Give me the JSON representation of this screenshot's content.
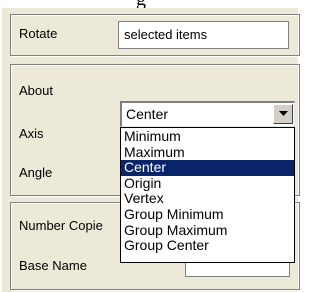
{
  "header": {
    "partial_title": "g"
  },
  "rotate": {
    "label": "Rotate",
    "value": "selected items"
  },
  "about": {
    "label": "About",
    "selected": "Center",
    "options": [
      "Minimum",
      "Maximum",
      "Center",
      "Origin",
      "Vertex",
      "Group Minimum",
      "Group Maximum",
      "Group Center"
    ],
    "highlighted_index": 2
  },
  "axis": {
    "label": "Axis"
  },
  "angle": {
    "label": "Angle"
  },
  "copies": {
    "label": "Number Copie"
  },
  "base": {
    "label": "Base Name"
  },
  "colors": {
    "panel": "#ece9d8",
    "highlight": "#0a246a"
  }
}
